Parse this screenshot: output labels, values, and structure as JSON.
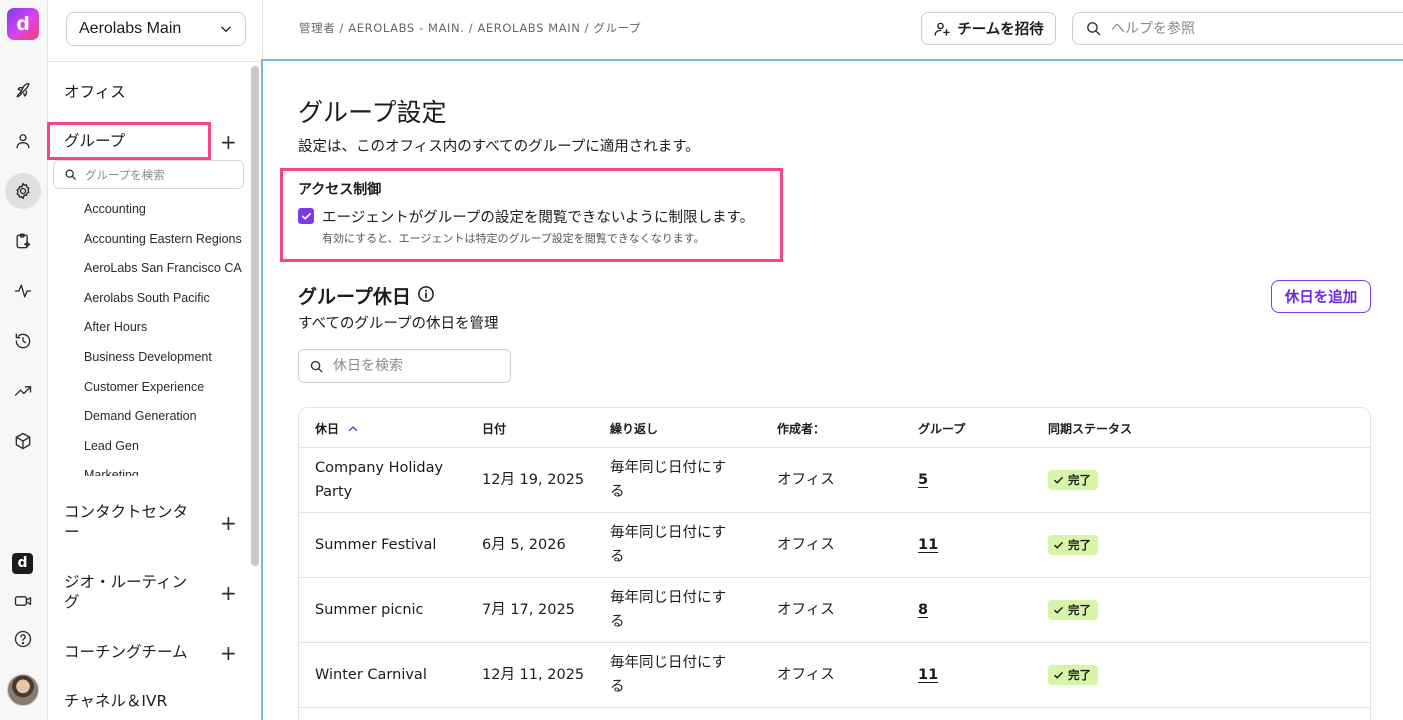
{
  "rail": {
    "logo_letter": "d",
    "badge_letter": "d",
    "icons": [
      "rocket-icon",
      "person-icon",
      "gear-icon",
      "clipboard-sparkle-icon",
      "activity-icon",
      "history-icon",
      "trending-icon",
      "cube-icon",
      "d-app-icon",
      "video-icon",
      "help-icon"
    ]
  },
  "sidebar": {
    "workspace": "Aerolabs Main",
    "office_label": "オフィス",
    "groups_label": "グループ",
    "group_search_placeholder": "グループを検索",
    "groups": [
      "Accounting",
      "Accounting Eastern Regions",
      "AeroLabs San Francisco CA",
      "Aerolabs South Pacific",
      "After Hours",
      "Business Development",
      "Customer Experience",
      "Demand Generation",
      "Lead Gen",
      "Marketing"
    ],
    "contact_center_line1": "コンタクトセンタ",
    "contact_center_line2": "ー",
    "geo_routing_line1": "ジオ・ルーティン",
    "geo_routing_line2": "グ",
    "coaching_team": "コーチングチーム",
    "channels_ivr": "チャネル＆IVR"
  },
  "topbar": {
    "breadcrumb": "管理者 / AEROLABS - MAIN. / AEROLABS MAIN / グループ",
    "invite_label": "チームを招待",
    "help_placeholder": "ヘルプを参照"
  },
  "main": {
    "title": "グループ設定",
    "subtitle": "設定は、このオフィス内のすべてのグループに適用されます。",
    "access": {
      "title": "アクセス制御",
      "checkbox_label": "エージェントがグループの設定を閲覧できないように制限します。",
      "checkbox_checked": true,
      "help": "有効にすると、エージェントは特定のグループ設定を閲覧できなくなります。"
    },
    "holidays": {
      "title": "グループ休日",
      "subtitle": "すべてのグループの休日を管理",
      "add_label": "休日を追加",
      "search_placeholder": "休日を検索",
      "columns": {
        "holiday": "休日",
        "date": "日付",
        "repeat": "繰り返し",
        "creator": "作成者：",
        "groups": "グループ",
        "sync": "同期ステータス"
      },
      "rows": [
        {
          "name_line1": "Company Holiday",
          "name_line2": "Party",
          "date": "12月 19, 2025",
          "repeat_line1": "毎年同じ日付にす",
          "repeat_line2": "る",
          "creator": "オフィス",
          "groups": "5",
          "sync": "完了"
        },
        {
          "name_line1": "Summer Festival",
          "name_line2": "",
          "date": "6月 5, 2026",
          "repeat_line1": "毎年同じ日付にす",
          "repeat_line2": "る",
          "creator": "オフィス",
          "groups": "11",
          "sync": "完了"
        },
        {
          "name_line1": "Summer picnic",
          "name_line2": "",
          "date": "7月 17, 2025",
          "repeat_line1": "毎年同じ日付にす",
          "repeat_line2": "る",
          "creator": "オフィス",
          "groups": "8",
          "sync": "完了"
        },
        {
          "name_line1": "Winter Carnival",
          "name_line2": "",
          "date": "12月 11, 2025",
          "repeat_line1": "毎年同じ日付にす",
          "repeat_line2": "る",
          "creator": "オフィス",
          "groups": "11",
          "sync": "完了"
        }
      ]
    }
  },
  "colors": {
    "accent": "#7c3aed",
    "highlight": "#f2478a",
    "focus_border": "#78b7ea",
    "success_badge": "#d6f5a8"
  }
}
